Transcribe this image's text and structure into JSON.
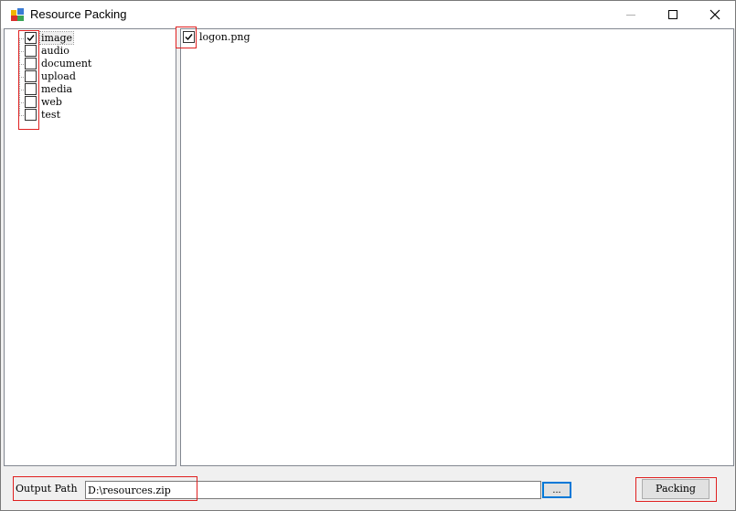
{
  "window": {
    "title": "Resource Packing",
    "minimize_icon": "minimize-icon",
    "maximize_icon": "maximize-icon",
    "close_icon": "close-icon"
  },
  "tree": {
    "items": [
      {
        "label": "image",
        "checked": true,
        "selected": true
      },
      {
        "label": "audio",
        "checked": false
      },
      {
        "label": "document",
        "checked": false
      },
      {
        "label": "upload",
        "checked": false
      },
      {
        "label": "media",
        "checked": false
      },
      {
        "label": "web",
        "checked": false
      },
      {
        "label": "test",
        "checked": false
      }
    ]
  },
  "files": {
    "items": [
      {
        "label": "logon.png",
        "checked": true
      }
    ]
  },
  "bottom": {
    "output_label": "Output Path",
    "output_value": "D:\\resources.zip",
    "browse_label": "...",
    "pack_label": "Packing"
  },
  "colors": {
    "highlight_box": "#e02020",
    "focus_border": "#0078d7"
  }
}
